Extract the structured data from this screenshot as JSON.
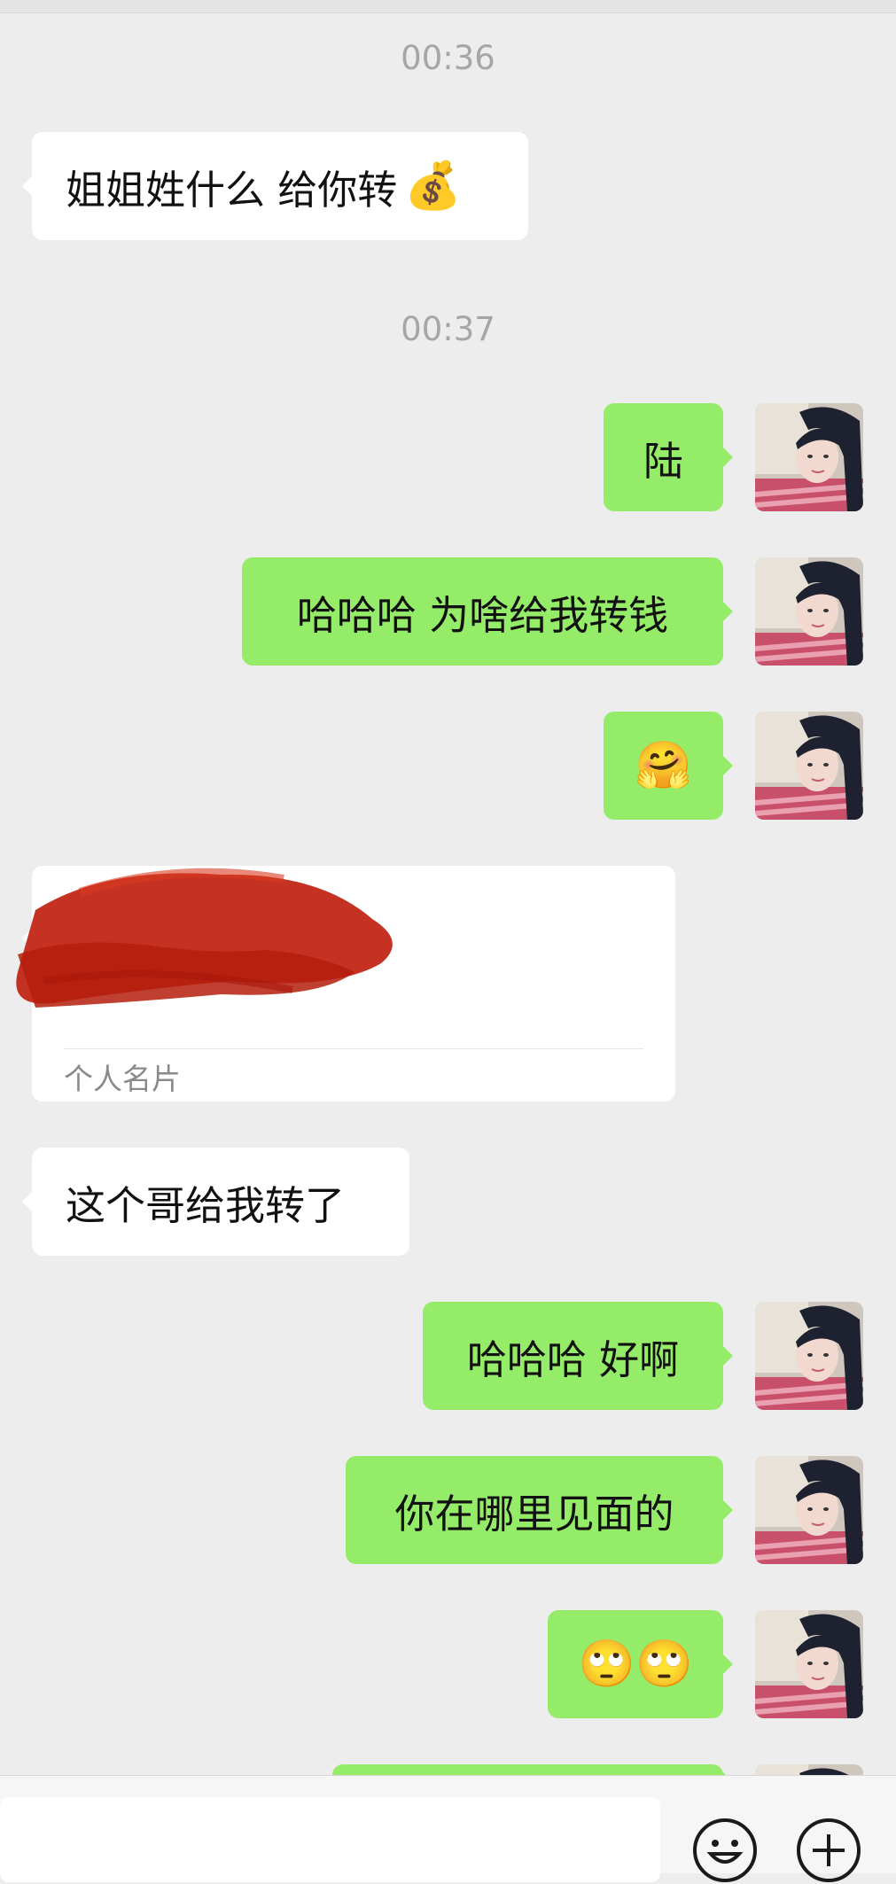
{
  "chat": {
    "time1": "00:36",
    "time2": "00:37",
    "msg1": "姐姐姓什么 给你转",
    "msg1_emoji": "💰",
    "msg2": "陆",
    "msg3": "哈哈哈 为啥给我转钱",
    "msg4_emoji": "🤗",
    "card_label": "个人名片",
    "msg5": "这个哥给我转了",
    "msg6": "哈哈哈 好啊",
    "msg7": "你在哪里见面的",
    "msg8_emoji": "🙄🙄"
  },
  "colors": {
    "background": "#ededed",
    "sent_bubble": "#95ec69",
    "received_bubble": "#ffffff",
    "timestamp": "#a6a6a6",
    "redaction": "#c0200f"
  },
  "input_bar": {
    "icons": [
      "emoji-icon",
      "plus-icon"
    ]
  }
}
